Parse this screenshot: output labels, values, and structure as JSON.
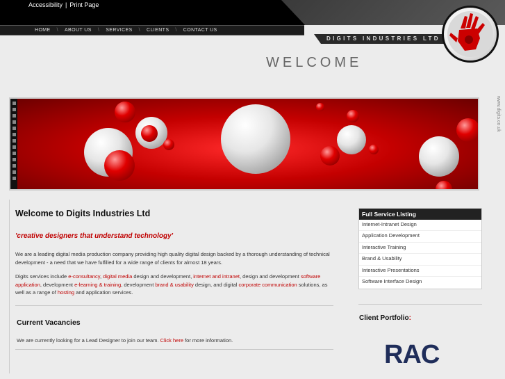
{
  "top_links": {
    "accessibility": "Accessibility",
    "separator": "|",
    "print_page": "Print Page"
  },
  "nav": {
    "items": [
      "HOME",
      "ABOUT US",
      "SERVICES",
      "CLIENTS",
      "CONTACT US"
    ],
    "separator": "\\"
  },
  "company_name": "DIGITS INDUSTRIES LTD",
  "page_heading": "WELCOME",
  "side_url": "www.digits.co.uk",
  "main": {
    "title": "Welcome to Digits Industries Ltd",
    "tagline": "'creative designers that understand technology'",
    "intro": "We are a leading digital media production company providing high quality digital design backed by a thorough understanding of technical development - a need that we have fulfilled for a wide range of clients for almost 18 years.",
    "services_text": {
      "p1": "Digits services include ",
      "l1": "e-consultancy",
      "p2": ", ",
      "l2": "digital media",
      "p3": " design and development, ",
      "l3": "internet and intranet",
      "p4": ", design and development ",
      "l4": "software application",
      "p5": ", development ",
      "l5": "e-learning & training",
      "p6": ", development ",
      "l6": "brand & usability",
      "p7": " design, and digital ",
      "l7": "corporate communication",
      "p8": " solutions, as well as a range of ",
      "l8": "hosting",
      "p9": " and application services."
    }
  },
  "vacancies": {
    "title": "Current Vacancies",
    "text_before": "We are currently looking for a Lead Designer to join our team. ",
    "link": "Click here",
    "text_after": " for more information."
  },
  "service_listing": {
    "title": "Full Service Listing",
    "items": [
      "Internet-Intranet Design",
      "Application Development",
      "Interactive Training",
      "Brand & Usability",
      "Interactive Presentations",
      "Software Interface Design"
    ]
  },
  "client_portfolio": {
    "title": "Client Portfolio",
    "colon": ":",
    "logo_text": "RAC"
  },
  "colors": {
    "accent_red": "#c00000",
    "nav_bg": "#1c1c1c",
    "top_bg": "#000000"
  }
}
